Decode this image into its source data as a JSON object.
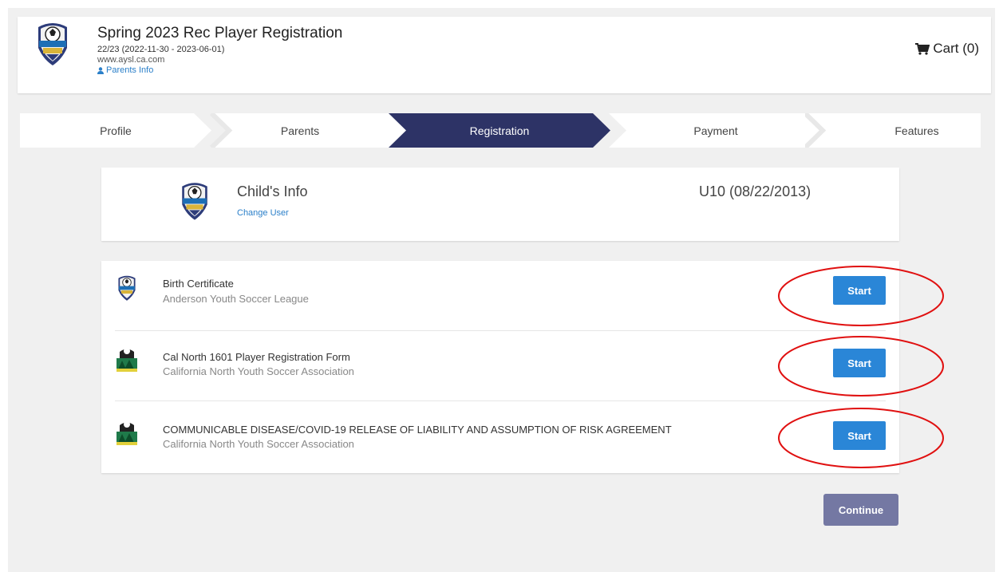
{
  "header": {
    "title": "Spring 2023 Rec Player Registration",
    "season": "22/23 (2022-11-30 - 2023-06-01)",
    "website": "www.aysl.ca.com",
    "parents_info": "Parents Info",
    "cart": "Cart (0)"
  },
  "stepper": {
    "steps": [
      "Profile",
      "Parents",
      "Registration",
      "Payment",
      "Features"
    ],
    "active": "Registration",
    "active_color": "#2d3366"
  },
  "child": {
    "title": "Child's Info",
    "change_user": "Change User",
    "age_group": "U10 (08/22/2013)"
  },
  "forms": [
    {
      "name": "Birth Certificate",
      "org": "Anderson Youth Soccer League",
      "icon": "league-shield-icon",
      "button": "Start"
    },
    {
      "name": "Cal North 1601 Player Registration Form",
      "org": "California North Youth Soccer Association",
      "icon": "cal-north-icon",
      "button": "Start"
    },
    {
      "name": "COMMUNICABLE DISEASE/COVID-19 RELEASE OF LIABILITY AND ASSUMPTION OF RISK AGREEMENT",
      "org": "California North Youth Soccer Association",
      "icon": "cal-north-icon",
      "button": "Start"
    }
  ],
  "continue_label": "Continue",
  "colors": {
    "accent": "#2a86d7",
    "link": "#2a7fc9",
    "continue": "#7478a3",
    "annotation": "#e01010"
  }
}
